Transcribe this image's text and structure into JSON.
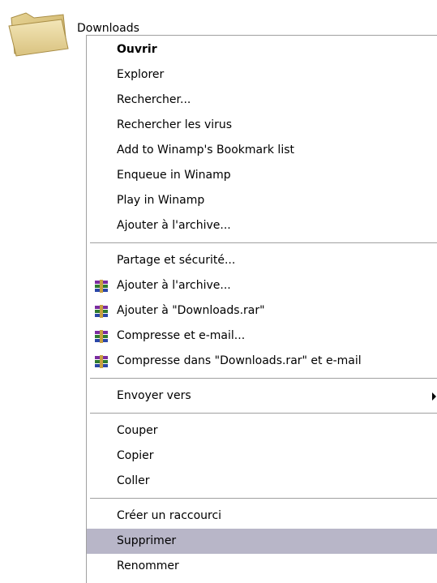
{
  "desktop": {
    "folder": {
      "name": "Downloads",
      "icon": "folder-icon"
    }
  },
  "context_menu": {
    "items": [
      {
        "label": "Ouvrir",
        "bold": true
      },
      {
        "label": "Explorer"
      },
      {
        "label": "Rechercher..."
      },
      {
        "label": "Rechercher les virus"
      },
      {
        "label": "Add to Winamp's Bookmark list"
      },
      {
        "label": "Enqueue in Winamp"
      },
      {
        "label": "Play in Winamp"
      },
      {
        "label": "Ajouter à l'archive..."
      },
      {
        "label": "Partage et sécurité..."
      },
      {
        "label": "Ajouter à l'archive...",
        "icon": "winrar-icon"
      },
      {
        "label": "Ajouter à \"Downloads.rar\"",
        "icon": "winrar-icon"
      },
      {
        "label": "Compresse et e-mail...",
        "icon": "winrar-icon"
      },
      {
        "label": "Compresse dans \"Downloads.rar\" et e-mail",
        "icon": "winrar-icon"
      },
      {
        "label": "Envoyer vers",
        "submenu": true
      },
      {
        "label": "Couper"
      },
      {
        "label": "Copier"
      },
      {
        "label": "Coller"
      },
      {
        "label": "Créer un raccourci"
      },
      {
        "label": "Supprimer",
        "selected": true
      },
      {
        "label": "Renommer"
      }
    ],
    "selected_color": "#b8b6c8"
  }
}
